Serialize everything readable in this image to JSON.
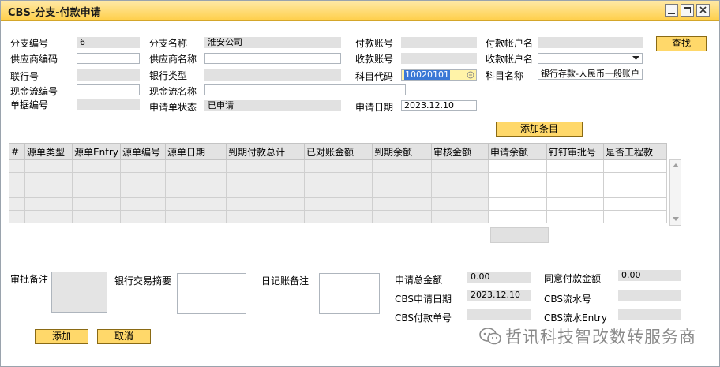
{
  "window": {
    "title": "CBS-分支-付款申请"
  },
  "header": {
    "branch_no_label": "分支编号",
    "branch_no_value": "6",
    "branch_name_label": "分支名称",
    "branch_name_value": "淮安公司",
    "pay_account_label": "付款账号",
    "pay_account_value": "",
    "pay_account_name_label": "付款帐户名",
    "pay_account_name_value": "",
    "vendor_code_label": "供应商编码",
    "vendor_code_value": "",
    "vendor_name_label": "供应商名称",
    "vendor_name_value": "",
    "recv_account_label": "收款账号",
    "recv_account_value": "",
    "recv_account_name_label": "收款帐户名",
    "recv_account_name_value": "",
    "bank_no_label": "联行号",
    "bank_no_value": "",
    "bank_type_label": "银行类型",
    "bank_type_value": "",
    "subject_code_label": "科目代码",
    "subject_code_value": "10020101",
    "subject_name_label": "科目名称",
    "subject_name_value": "银行存款-人民币一般账户",
    "cashflow_code_label": "现金流编号",
    "cashflow_code_value": "",
    "cashflow_name_label": "现金流名称",
    "cashflow_name_value": "",
    "doc_no_label": "单据编号",
    "doc_no_value": "",
    "status_label": "申请单状态",
    "status_value": "已申请",
    "apply_date_label": "申请日期",
    "apply_date_value": "2023.12.10"
  },
  "buttons": {
    "find": "查找",
    "add_row": "添加条目",
    "add": "添加",
    "cancel": "取消"
  },
  "grid": {
    "columns": [
      "#",
      "源单类型",
      "源单Entry",
      "源单编号",
      "源单日期",
      "到期付款总计",
      "已对账金额",
      "到期余额",
      "审核金额",
      "申请余额",
      "钉钉审批号",
      "是否工程款"
    ]
  },
  "footer": {
    "approval_note_label": "审批备注",
    "bank_summary_label": "银行交易摘要",
    "journal_note_label": "日记账备注",
    "total_apply_label": "申请总金额",
    "total_apply_value": "0.00",
    "agree_pay_label": "同意付款金额",
    "agree_pay_value": "0.00",
    "cbs_apply_date_label": "CBS申请日期",
    "cbs_apply_date_value": "2023.12.10",
    "cbs_serial_label": "CBS流水号",
    "cbs_serial_value": "",
    "cbs_pay_no_label": "CBS付款单号",
    "cbs_pay_no_value": "",
    "cbs_serial_entry_label": "CBS流水Entry",
    "cbs_serial_entry_value": ""
  },
  "watermark": {
    "text": "哲讯科技智改数转服务商"
  }
}
